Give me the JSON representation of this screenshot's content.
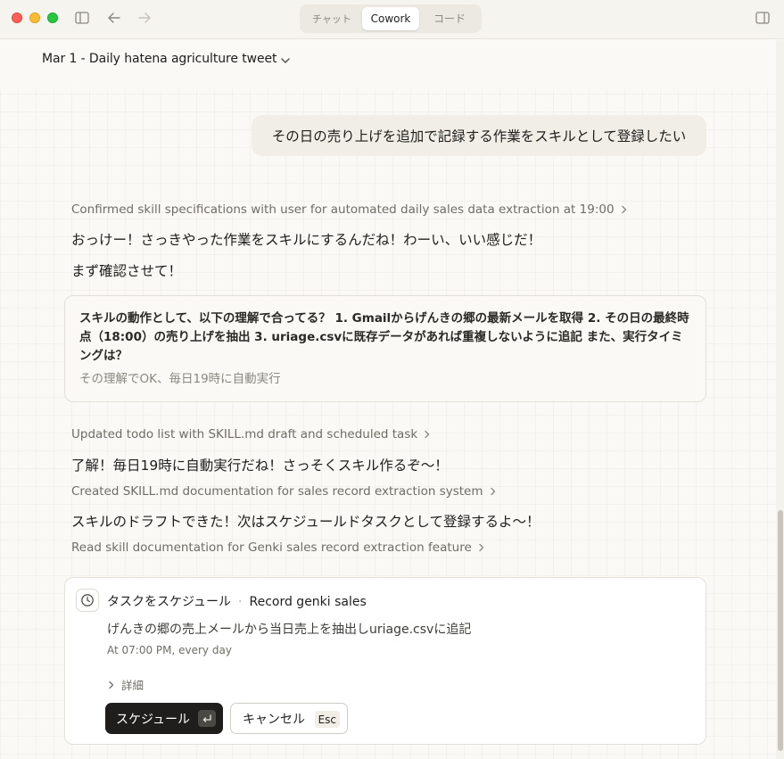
{
  "tabs": {
    "chat": "チャット",
    "cowork": "Cowork",
    "code": "コード"
  },
  "conversation": {
    "title": "Mar 1 - Daily hatena agriculture tweet"
  },
  "messages": {
    "user": "その日の売り上げを追加で記録する作業をスキルとして登録したい",
    "step1": "Confirmed skill specifications with user for automated daily sales data extraction at 19:00",
    "reply1": "おっけー！さっきやった作業をスキルにするんだね！わーい、いい感じだ！",
    "reply2": "まず確認させて！",
    "qa": {
      "question": "スキルの動作として、以下の理解で合ってる？ 1. Gmailからげんきの郷の最新メールを取得 2. その日の最終時点（18:00）の売り上げを抽出 3. uriage.csvに既存データがあれば重複しないように追記 また、実行タイミングは？",
      "answer": "その理解でOK、毎日19時に自動実行"
    },
    "step2": "Updated todo list with SKILL.md draft and scheduled task",
    "reply3": "了解！毎日19時に自動実行だね！さっそくスキル作るぞ〜！",
    "step3": "Created SKILL.md documentation for sales record extraction system",
    "reply4": "スキルのドラフトできた！次はスケジュールドタスクとして登録するよ〜！",
    "step4": "Read skill documentation for Genki sales record extraction feature"
  },
  "schedule_card": {
    "icon": "clock-icon",
    "title": "タスクをスケジュール",
    "separator": "·",
    "task_name": "Record genki sales",
    "description": "げんきの郷の売上メールから当日売上を抽出しuriage.csvに追記",
    "time": "At 07:00 PM, every day",
    "details_label": "詳細",
    "schedule_button": "スケジュール",
    "schedule_shortcut": "↩",
    "cancel_button": "キャンセル",
    "cancel_shortcut": "Esc"
  }
}
